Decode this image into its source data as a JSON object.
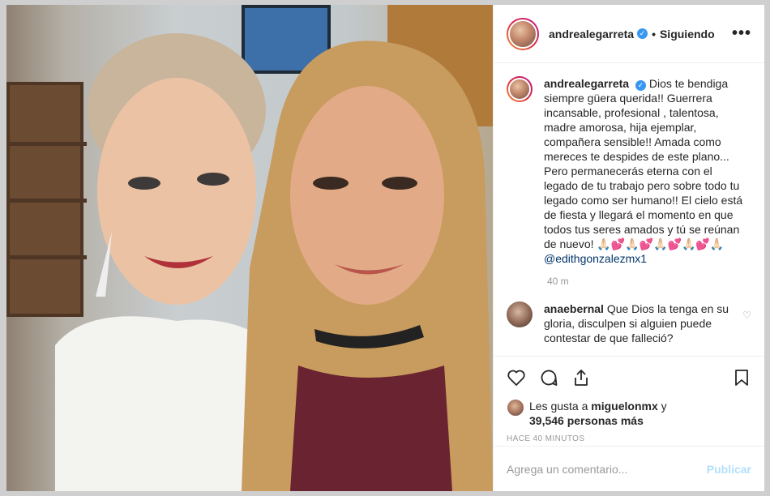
{
  "header": {
    "username": "andrealegarreta",
    "separator": "•",
    "follow_status": "Siguiendo",
    "more_label": "•••"
  },
  "caption": {
    "username": "andrealegarreta",
    "text": "Dios te bendiga siempre güera querida!! Guerrera incansable, profesional , talentosa, madre amorosa, hija ejemplar, compañera sensible!! Amada como mereces te despides de este plano... Pero permanecerás eterna con el legado de tu trabajo pero sobre todo tu legado como ser humano!! El cielo está de fiesta y llegará el momento en que todos tus seres amados y tú se reúnan de nuevo! 🙏🏻💕🙏🏻💕🙏🏻💕🙏🏻💕🙏🏻",
    "mention": "@edithgonzalezmx1",
    "time": "40 m"
  },
  "comments": [
    {
      "username": "anaebernal",
      "text": "Que Dios la tenga en su gloria, disculpen si alguien puede contestar de que falleció?"
    }
  ],
  "likes": {
    "prefix": "Les gusta a",
    "user": "miguelonmx",
    "conj": "y",
    "count_text": "39,546 personas más"
  },
  "posted_ago": "HACE 40 MINUTOS",
  "add_comment": {
    "placeholder": "Agrega un comentario...",
    "publish_label": "Publicar"
  },
  "icons": {
    "like": "heart-icon",
    "comment": "comment-icon",
    "share": "share-icon",
    "save": "bookmark-icon",
    "verified": "verified-badge-icon"
  },
  "colors": {
    "verified": "#3897f0",
    "publish_disabled": "#b2dffc",
    "mention": "#003569"
  }
}
